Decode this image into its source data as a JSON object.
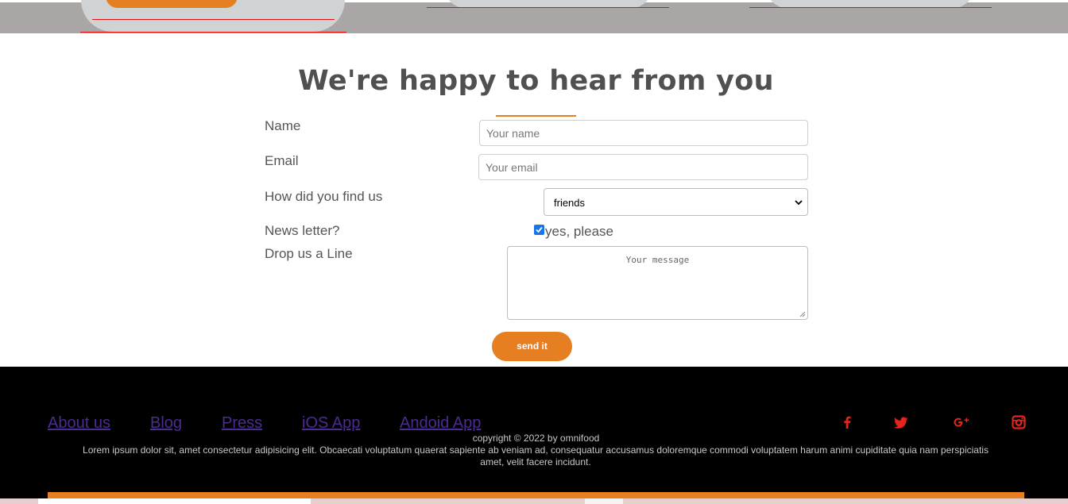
{
  "form": {
    "heading": "We're happy to hear from you",
    "name_label": "Name",
    "name_placeholder": "Your name",
    "email_label": "Email",
    "email_placeholder": "Your email",
    "find_label": "How did you find us",
    "find_selected": "friends",
    "newsletter_label": "News letter?",
    "newsletter_checked": true,
    "newsletter_option": "yes, please",
    "message_label": "Drop us a Line",
    "message_placeholder": "Your message",
    "send_label": "send it"
  },
  "footer": {
    "links": [
      {
        "label": "About us"
      },
      {
        "label": "Blog"
      },
      {
        "label": "Press"
      },
      {
        "label": "iOS App"
      },
      {
        "label": "Andoid App"
      }
    ],
    "social_icons": [
      "facebook-icon",
      "twitter-icon",
      "google-plus-icon",
      "instagram-icon"
    ],
    "copyright": "copyright © 2022 by omnifood",
    "lorem": "Lorem ipsum dolor sit, amet consectetur adipisicing elit. Obcaecati voluptatum quaerat sapiente ab veniam ad, consequatur accusamus doloremque commodi voluptatem harum animi cupiditate quia nam perspiciatis amet, velit facere incidunt."
  },
  "colors": {
    "accent": "#e67e22",
    "link": "#4b2c8f",
    "social": "#e3251b",
    "footer_bg": "#000000",
    "top_band": "#aba6a6"
  }
}
